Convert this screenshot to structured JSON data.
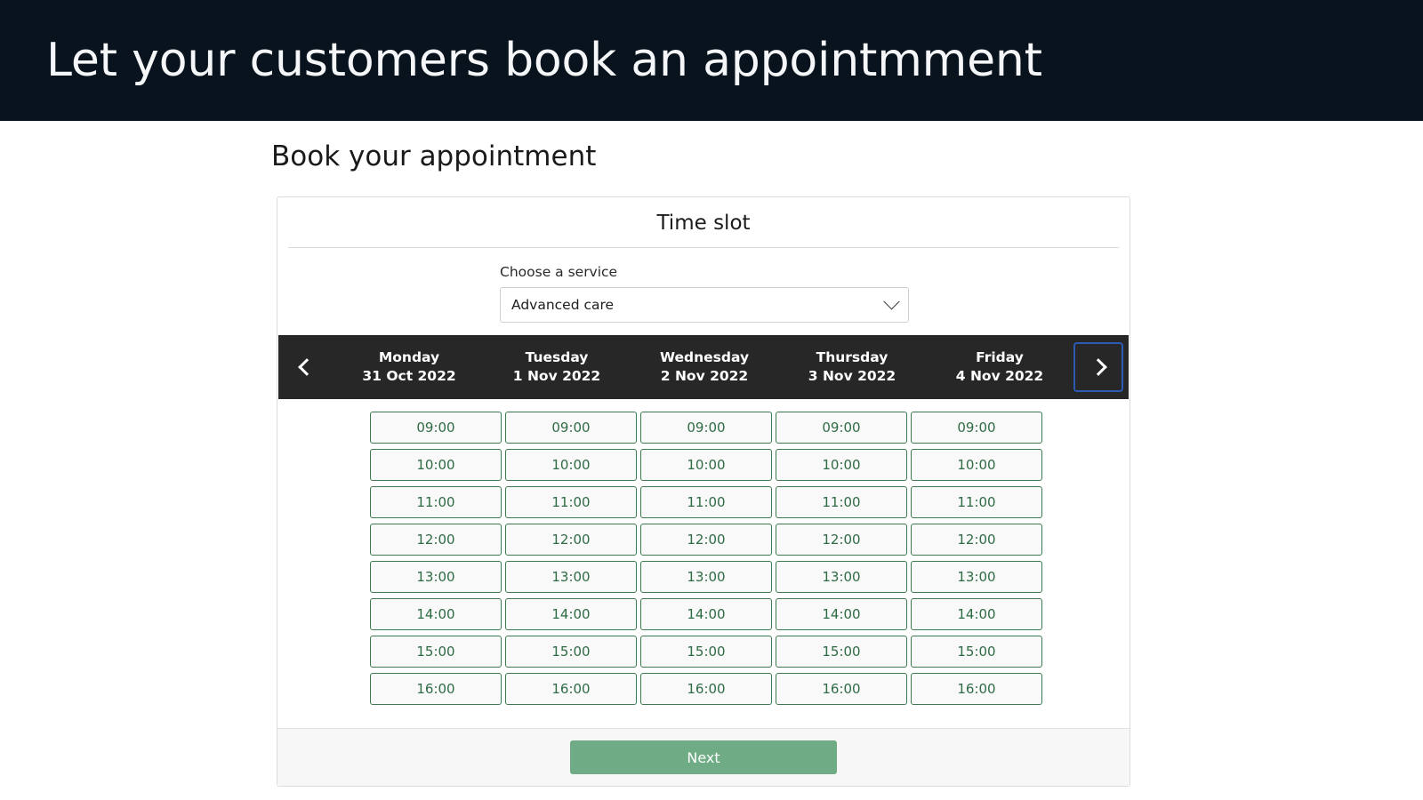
{
  "header": {
    "title": "Let your customers book an appointmment",
    "background_color": "#08131e"
  },
  "page": {
    "title": "Book your appointment"
  },
  "card": {
    "title": "Time slot",
    "service": {
      "label": "Choose a service",
      "selected": "Advanced care",
      "chevron_icon": "chevron-down-icon"
    },
    "nav": {
      "prev_icon": "chevron-left-icon",
      "next_icon": "chevron-right-icon",
      "focus_color": "#2b5bb5",
      "bar_color": "#272727"
    },
    "days": [
      {
        "name": "Monday",
        "date": "31 Oct 2022"
      },
      {
        "name": "Tuesday",
        "date": "1 Nov 2022"
      },
      {
        "name": "Wednesday",
        "date": "2 Nov 2022"
      },
      {
        "name": "Thursday",
        "date": "3 Nov 2022"
      },
      {
        "name": "Friday",
        "date": "4 Nov 2022"
      }
    ],
    "slots": [
      [
        "09:00",
        "10:00",
        "11:00",
        "12:00",
        "13:00",
        "14:00",
        "15:00",
        "16:00"
      ],
      [
        "09:00",
        "10:00",
        "11:00",
        "12:00",
        "13:00",
        "14:00",
        "15:00",
        "16:00"
      ],
      [
        "09:00",
        "10:00",
        "11:00",
        "12:00",
        "13:00",
        "14:00",
        "15:00",
        "16:00"
      ],
      [
        "09:00",
        "10:00",
        "11:00",
        "12:00",
        "13:00",
        "14:00",
        "15:00",
        "16:00"
      ],
      [
        "09:00",
        "10:00",
        "11:00",
        "12:00",
        "13:00",
        "14:00",
        "15:00",
        "16:00"
      ]
    ],
    "slot_colors": {
      "border": "#3d7a4f",
      "text": "#2f6b44",
      "background": "#f8f9f8"
    },
    "footer": {
      "next_label": "Next",
      "next_color": "#6fab84"
    }
  }
}
